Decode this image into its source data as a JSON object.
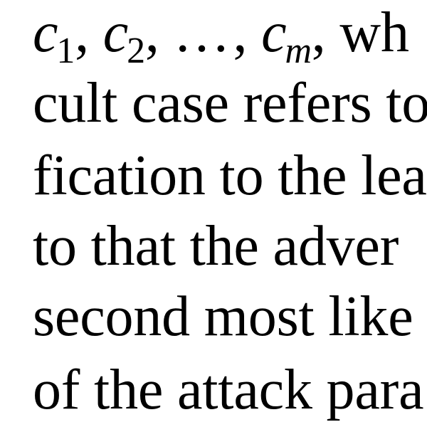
{
  "text": {
    "line1": {
      "c": "c",
      "sub1": "1",
      "sep": ",",
      "sub2": "2",
      "ellipsis": "…",
      "subm": "m",
      "tail": ", wh"
    },
    "line2": "cult case refers to",
    "line3": "fication to the lea",
    "line4": "to that the adver",
    "line5": "second most like",
    "line6": "of the attack para"
  }
}
